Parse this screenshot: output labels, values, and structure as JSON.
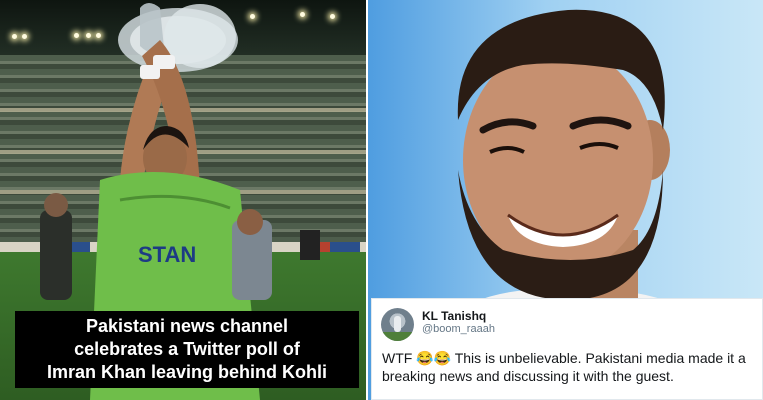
{
  "caption": {
    "lines": [
      "Pakistani news channel",
      "celebrates  a Twitter poll of",
      "Imran Khan leaving behind Kohli"
    ]
  },
  "tweet": {
    "name": "KL Tanishq",
    "handle": "@boom_raaah",
    "text": "WTF 😂😂 This is unbelievable. Pakistani media made it a breaking news and discussing it with the guest."
  },
  "colors": {
    "caption_bg": "#000000",
    "caption_text": "#ffffff",
    "tweet_handle": "#657786",
    "right_background": "#6fb3e8",
    "pitch": "#3f7a2f",
    "jersey": "#6fbe4a"
  }
}
